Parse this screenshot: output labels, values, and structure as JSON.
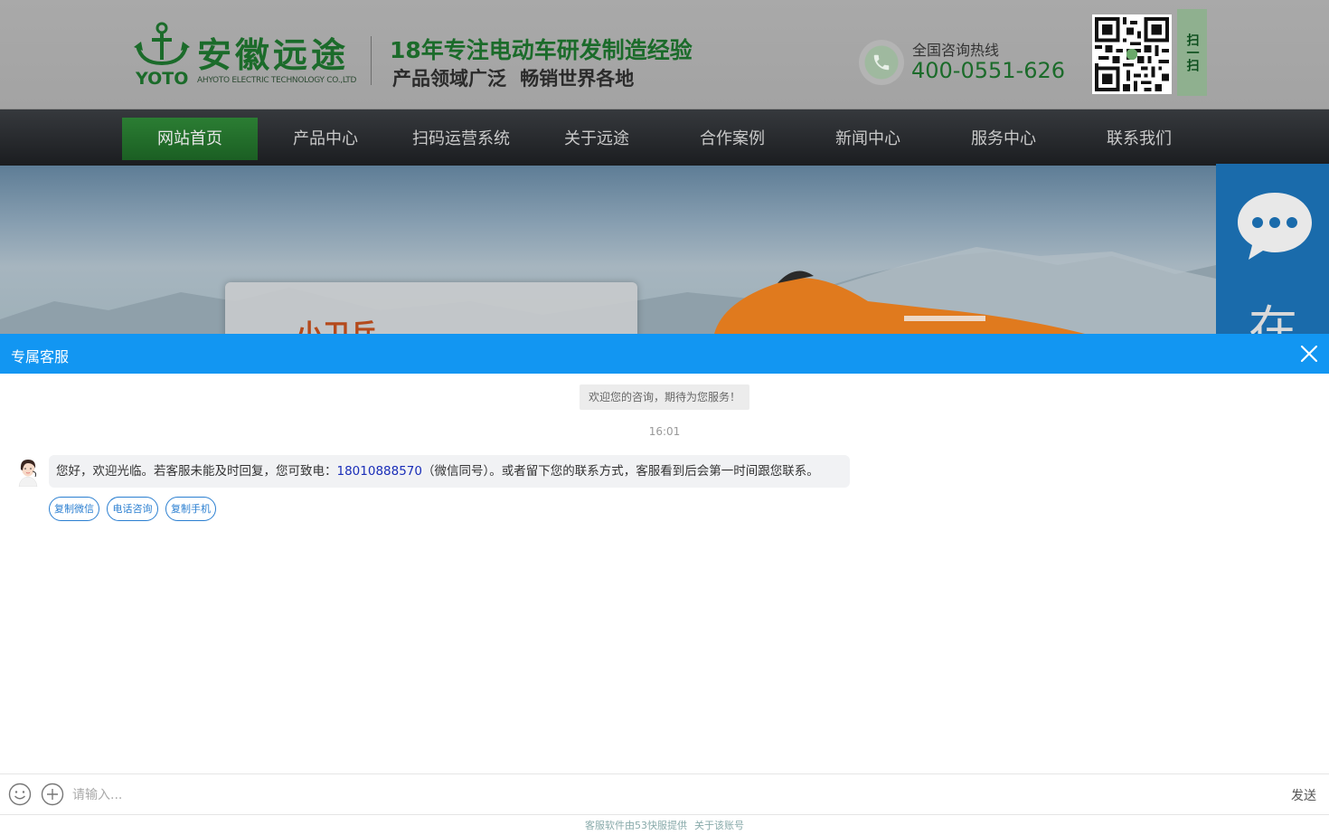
{
  "site": {
    "logo": {
      "name_cn": "安徽远途",
      "name_en": "YOTO",
      "company_en": "AHYOTO ELECTRIC TECHNOLOGY CO.,LTD"
    },
    "slogan_line1": "18年专注电动车研发制造经验",
    "slogan_line2": "产品领域广泛  畅销世界各地",
    "hotline_label": "全国咨询热线",
    "hotline_number": "400-0551-626",
    "qr_tab_label": "扫一扫",
    "nav": [
      {
        "label": "网站首页",
        "active": true
      },
      {
        "label": "产品中心"
      },
      {
        "label": "扫码运营系统"
      },
      {
        "label": "关于远途"
      },
      {
        "label": "合作案例"
      },
      {
        "label": "新闻中心"
      },
      {
        "label": "服务中心"
      },
      {
        "label": "联系我们"
      }
    ],
    "banner_title": "小卫兵",
    "side_widget_char": "在"
  },
  "chat": {
    "title": "专属客服",
    "welcome": "欢迎您的咨询，期待为您服务！",
    "time": "16:01",
    "message": {
      "prefix": "您好，欢迎光临。若客服未能及时回复，您可致电：",
      "phone": "18010888570",
      "suffix": "（微信同号）。或者留下您的联系方式，客服看到后会第一时间跟您联系。"
    },
    "quick_actions": [
      "复制微信",
      "电话咨询",
      "复制手机"
    ],
    "input_placeholder": "请输入...",
    "send_label": "发送",
    "footer_provider": "客服软件由53快服提供",
    "footer_about": "关于该账号"
  },
  "colors": {
    "chat_header": "#1296f2",
    "brand_green": "#1b6b2a",
    "link_blue": "#2b7fd1"
  }
}
